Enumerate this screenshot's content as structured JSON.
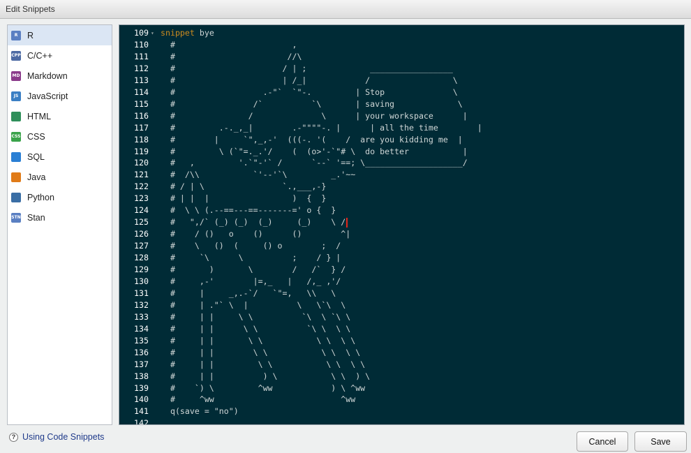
{
  "window": {
    "title": "Edit Snippets"
  },
  "sidebar": {
    "items": [
      {
        "label": "R",
        "icon": "r-file-icon",
        "color": "#5a7fc2",
        "abbr": "R",
        "selected": true
      },
      {
        "label": "C/C++",
        "icon": "cpp-file-icon",
        "color": "#4d6aa3",
        "abbr": "CPP",
        "selected": false
      },
      {
        "label": "Markdown",
        "icon": "markdown-file-icon",
        "color": "#8a3a8a",
        "abbr": "MD",
        "selected": false
      },
      {
        "label": "JavaScript",
        "icon": "javascript-file-icon",
        "color": "#3b7fc4",
        "abbr": "JS",
        "selected": false
      },
      {
        "label": "HTML",
        "icon": "html-globe-icon",
        "color": "#2f8f5a",
        "abbr": "",
        "selected": false
      },
      {
        "label": "CSS",
        "icon": "css-file-icon",
        "color": "#3aa34a",
        "abbr": "CSS",
        "selected": false
      },
      {
        "label": "SQL",
        "icon": "sql-database-icon",
        "color": "#2a7fd4",
        "abbr": "",
        "selected": false
      },
      {
        "label": "Java",
        "icon": "java-cup-icon",
        "color": "#e07b18",
        "abbr": "",
        "selected": false
      },
      {
        "label": "Python",
        "icon": "python-logo-icon",
        "color": "#3a6ea5",
        "abbr": "",
        "selected": false
      },
      {
        "label": "Stan",
        "icon": "stan-file-icon",
        "color": "#5a7fc2",
        "abbr": "STN",
        "selected": false
      }
    ]
  },
  "editor": {
    "lines": [
      {
        "n": "109",
        "fold": true,
        "kw": "snippet",
        "text": " bye"
      },
      {
        "n": "110",
        "text": "  #                        ,"
      },
      {
        "n": "111",
        "text": "  #                       //\\"
      },
      {
        "n": "112",
        "text": "  #                      / | ;             _________________"
      },
      {
        "n": "113",
        "text": "  #                      | /_|            /                 \\"
      },
      {
        "n": "114",
        "text": "  #                  .-\"`  `\"-.         | Stop              \\"
      },
      {
        "n": "115",
        "text": "  #                /`          `\\       | saving             \\"
      },
      {
        "n": "116",
        "text": "  #               /              \\      | your workspace      |"
      },
      {
        "n": "117",
        "text": "  #         .-._,_|        .-\"\"\"\"-. |      | all the time        |"
      },
      {
        "n": "118",
        "text": "  #        |     `\",_,-'  (((-. '(    /  are you kidding me  |"
      },
      {
        "n": "119",
        "text": "  #         \\ (`\"=._.'/    (  (o>'-`\"# \\  do better           |"
      },
      {
        "n": "120",
        "text": "  #   ,         '.`\"-'` /      `--` '==; \\____________________/"
      },
      {
        "n": "121",
        "text": "  #  /\\\\           `'--'`\\         _.'~~"
      },
      {
        "n": "122",
        "text": "  # / | \\                `.,___,-}"
      },
      {
        "n": "123",
        "text": "  # | |  |                 )  {  }"
      },
      {
        "n": "124",
        "text": "  #  \\ \\ (.--==---==-------=' o {  }"
      },
      {
        "n": "125",
        "text": "  #   \",/` (_) (_)  (_)     (_)    \\ /",
        "caret": true
      },
      {
        "n": "126",
        "text": "  #    / ()   o    ()      ()        ^|"
      },
      {
        "n": "127",
        "text": "  #    \\   ()  (     () o        ;  /"
      },
      {
        "n": "128",
        "text": "  #     `\\      \\          ;    / } |"
      },
      {
        "n": "129",
        "text": "  #       )       \\        /   /`  } /"
      },
      {
        "n": "130",
        "text": "  #     ,-'        |=,_   |   /,_ ,'/"
      },
      {
        "n": "131",
        "text": "  #     |     _,.-`/   `\"=,   \\\\   \\"
      },
      {
        "n": "132",
        "text": "  #     | .\"` \\  |          \\   \\`\\  \\"
      },
      {
        "n": "133",
        "text": "  #     | |     \\ \\          `\\  \\ `\\ \\"
      },
      {
        "n": "134",
        "text": "  #     | |      \\ \\          `\\ \\  \\ \\"
      },
      {
        "n": "135",
        "text": "  #     | |       \\ \\           \\ \\  \\ \\"
      },
      {
        "n": "136",
        "text": "  #     | |        \\ \\           \\ \\  \\ \\"
      },
      {
        "n": "137",
        "text": "  #     | |         \\ \\           \\ \\  \\ \\"
      },
      {
        "n": "138",
        "text": "  #     | |          ) \\           \\ \\  ) \\"
      },
      {
        "n": "139",
        "text": "  #    `) \\         ^ww            ) \\ ^ww"
      },
      {
        "n": "140",
        "text": "  #     ^ww                          ^ww"
      },
      {
        "n": "141",
        "text": "  q(save = \"no\")"
      },
      {
        "n": "142",
        "text": ""
      }
    ]
  },
  "footer": {
    "help_label": "Using Code Snippets",
    "cancel_label": "Cancel",
    "save_label": "Save"
  }
}
